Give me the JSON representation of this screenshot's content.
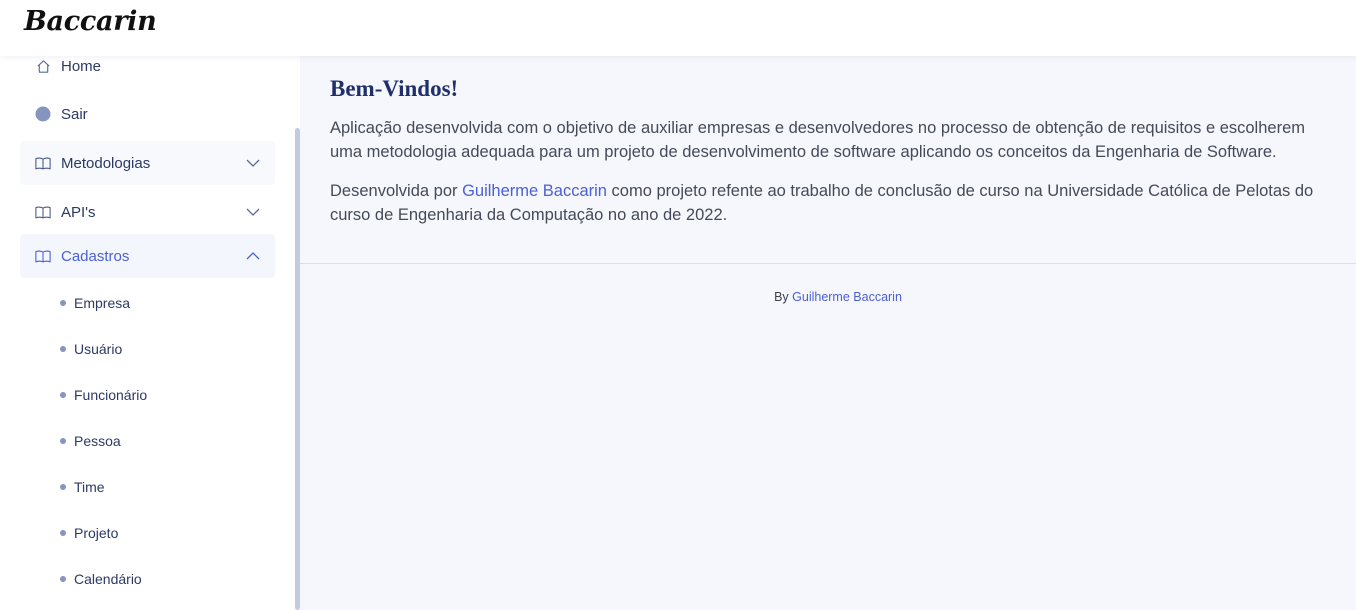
{
  "header": {
    "logo_text": "Baccarin"
  },
  "sidebar": {
    "items": [
      {
        "label": "Home",
        "icon": "home-icon"
      },
      {
        "label": "Sair",
        "icon": "circle-icon"
      },
      {
        "label": "Metodologias",
        "icon": "book-icon",
        "expanded": false
      },
      {
        "label": "API's",
        "icon": "book-icon",
        "expanded": false
      },
      {
        "label": "Cadastros",
        "icon": "book-icon",
        "expanded": true
      }
    ],
    "cadastros_items": [
      "Empresa",
      "Usuário",
      "Funcionário",
      "Pessoa",
      "Time",
      "Projeto",
      "Calendário"
    ]
  },
  "main": {
    "title": "Bem-Vindos!",
    "paragraph1": "Aplicação desenvolvida com o objetivo de auxiliar empresas e desenvolvedores no processo de obtenção de requisitos e escolherem uma metodologia adequada para um projeto de desenvolvimento de software aplicando os conceitos da Engenharia de Software.",
    "paragraph2_prefix": "Desenvolvida por ",
    "paragraph2_link": "Guilherme Baccarin",
    "paragraph2_suffix": " como projeto refente ao trabalho de conclusão de curso na Universidade Católica de Pelotas do curso de Engenharia da Computação no ano de 2022."
  },
  "footer": {
    "prefix": "By ",
    "link": "Guilherme Baccarin"
  },
  "colors": {
    "accent": "#4b5fd6",
    "nav_text": "#2c3a63",
    "title": "#1f2f6b",
    "background": "#f5f7fd"
  }
}
